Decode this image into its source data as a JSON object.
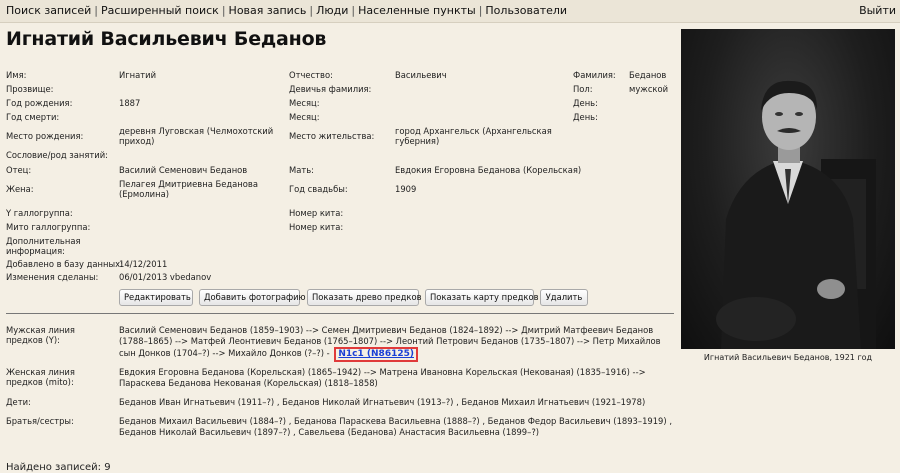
{
  "nav": {
    "links": [
      "Поиск записей",
      "Расширенный поиск",
      "Новая запись",
      "Люди",
      "Населенные пункты",
      "Пользователи"
    ],
    "logout": "Выйти"
  },
  "person": {
    "full_name": "Игнатий Васильевич Беданов"
  },
  "fields": {
    "name_label": "Имя:",
    "name": "Игнатий",
    "patronymic_label": "Отчество:",
    "patronymic": "Васильевич",
    "surname_label": "Фамилия:",
    "surname": "Беданов",
    "nickname_label": "Прозвище:",
    "maiden_label": "Девичья фамилия:",
    "sex_label": "Пол:",
    "sex": "мужской",
    "birth_year_label": "Год рождения:",
    "birth_year": "1887",
    "birth_month_label": "Месяц:",
    "birth_day_label": "День:",
    "death_year_label": "Год смерти:",
    "death_month_label": "Месяц:",
    "death_day_label": "День:",
    "birthplace_label": "Место рождения:",
    "birthplace": "деревня Луговская (Челмохотский приход)",
    "residence_label": "Место жительства:",
    "residence": "город Архангельск (Архангельская губерния)",
    "estate_label": "Сословие/род занятий:",
    "father_label": "Отец:",
    "father": "Василий Семенович Беданов",
    "mother_label": "Мать:",
    "mother": "Евдокия Егоровна Беданова (Корельская)",
    "wife_label": "Жена:",
    "wife": "Пелагея Дмитриевна Беданова (Ермолина)",
    "wedding_label": "Год свадьбы:",
    "wedding": "1909",
    "y_label": "Y галлогруппа:",
    "kit1_label": "Номер кита:",
    "mt_label": "Мито галлогруппа:",
    "kit2_label": "Номер кита:",
    "extra_label": "Дополнительная информация:",
    "added_label": "Добавлено в базу данных:",
    "added": "14/12/2011",
    "changed_label": "Изменения сделаны:",
    "changed": "06/01/2013 vbedanov"
  },
  "buttons": {
    "edit": "Редактировать",
    "add_photo": "Добавить фотографию",
    "show_tree": "Показать древо предков",
    "show_map": "Показать карту предков",
    "delete": "Удалить"
  },
  "lines": {
    "male_label": "Мужская линия предков (Y):",
    "male_text": "Василий Семенович Беданов (1859–1903) --> Семен Дмитриевич Беданов (1824–1892) --> Дмитрий Матфеевич Беданов (1788–1865) --> Матфей Леонтиевич Беданов (1765–1807) --> Леонтий Петрович Беданов (1735–1807) --> Петр Михайлов сын Донков (1704–?) --> Михайло Донков (?–?) -",
    "male_haplogroup": "N1c1 (N86125)",
    "female_label": "Женская линия предков (mito):",
    "female_text": "Евдокия Егоровна Беданова (Корельская) (1865–1942) --> Матрена Ивановна Корельская (Некованая) (1835–1916) --> Параскева Беданова Некованая (Корельская) (1818–1858)",
    "children_label": "Дети:",
    "children_text": "Беданов Иван Игнатьевич (1911–?) , Беданов Николай Игнатьевич (1913–?) , Беданов Михаил Игнатьевич (1921–1978)",
    "siblings_label": "Братья/сестры:",
    "siblings_text": "Беданов Михаил Васильевич (1884–?) , Беданова Параскева Васильевна (1888–?) , Беданов Федор Васильевич (1893–1919) , Беданов Николай Васильевич (1897–?) , Савельева (Беданова) Анастасия Васильевна (1899–?)"
  },
  "photo": {
    "caption": "Игнатий Васильевич Беданов, 1921 год"
  },
  "footer": {
    "found": "Найдено записей: 9"
  }
}
